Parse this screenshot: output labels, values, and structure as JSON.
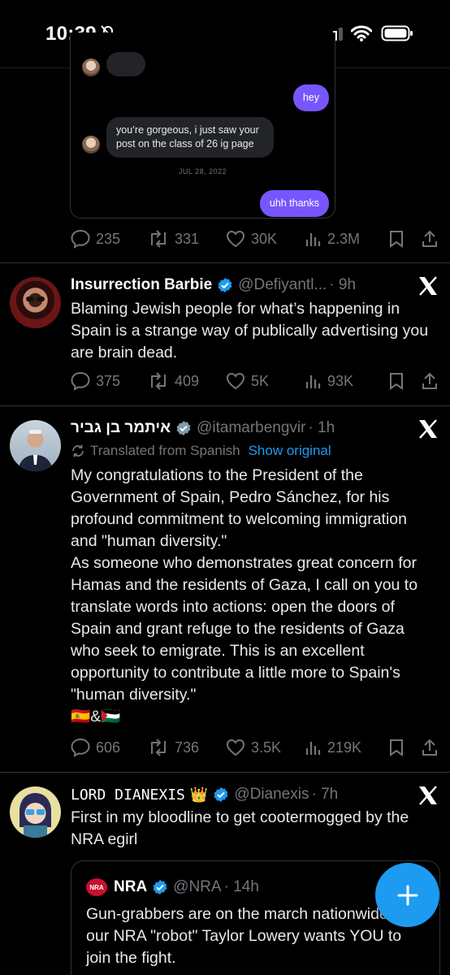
{
  "status_bar": {
    "time": "10:39"
  },
  "dm_preview": {
    "msg_out_1": "hey",
    "msg_in_1": "you’re gorgeous, i just saw your post on the class of 26 ig page",
    "date": "JUL 28, 2022",
    "msg_out_2": "uhh thanks"
  },
  "tweets": [
    {
      "actions": {
        "replies": "235",
        "reposts": "331",
        "likes": "30K",
        "views": "2.3M"
      }
    },
    {
      "name": "Insurrection Barbie",
      "handle": "@Defiyantl...",
      "time": "· 9h",
      "text": "Blaming Jewish people for what’s happening in Spain is a strange way of publically advertising you are brain dead.",
      "actions": {
        "replies": "375",
        "reposts": "409",
        "likes": "5K",
        "views": "93K"
      }
    },
    {
      "name": "איתמר בן גביר",
      "handle": "@itamarbengvir",
      "time": "· 1h",
      "translated_label": "Translated from Spanish",
      "show_original": "Show original",
      "text": "My congratulations to the President of the Government of Spain, Pedro Sánchez, for his profound commitment to welcoming immigration and \"human diversity.\"\nAs someone who demonstrates great concern for Hamas and the residents of Gaza, I call on you to translate words into actions: open the doors of Spain and grant refuge to the residents of Gaza who seek to emigrate. This is an excellent opportunity to contribute a little more to Spain's \"human diversity.\"\n🇪🇸&🇵🇸",
      "actions": {
        "replies": "606",
        "reposts": "736",
        "likes": "3.5K",
        "views": "219K"
      }
    },
    {
      "name": "𝙻𝙾𝚁𝙳 𝙳𝙸𝙰𝙽𝙴𝚇𝙸𝚂",
      "name_emoji": "👑",
      "handle": "@Dianexis",
      "time": "· 7h",
      "text": "First in my bloodline to get cootermogged by the NRA egirl",
      "quote": {
        "logo_text": "NRA",
        "name": "NRA",
        "handle": "@NRA",
        "time": "· 14h",
        "text": "Gun-grabbers are on the march nationwide and our NRA \"robot\" Taylor Lowery wants YOU to join the fight."
      }
    }
  ],
  "colors": {
    "accent": "#1d9bf0",
    "dm_purple": "#7856ff",
    "muted": "#71767b"
  }
}
